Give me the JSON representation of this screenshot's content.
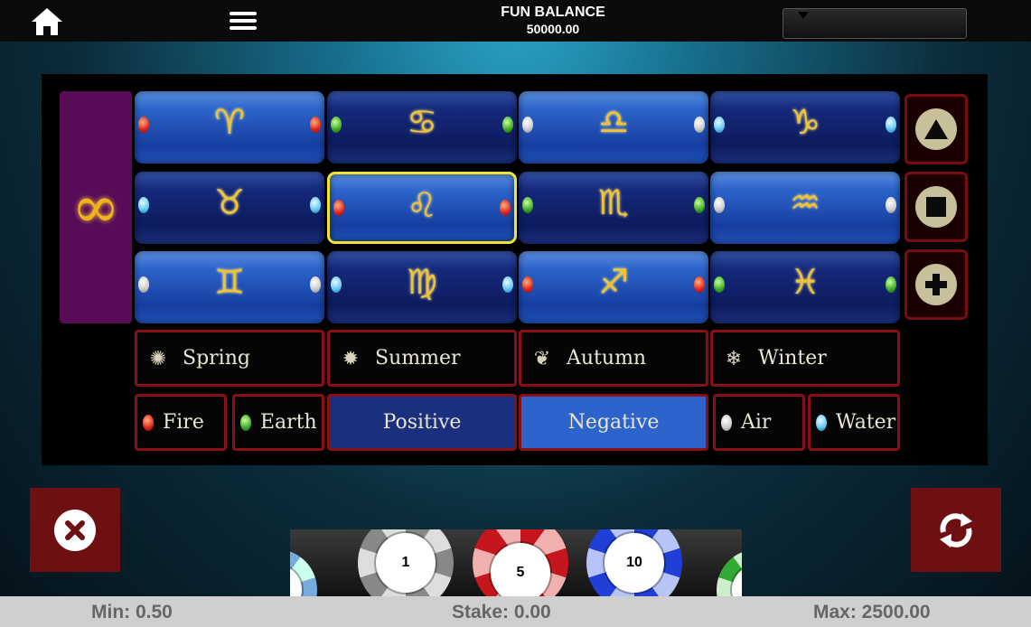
{
  "header": {
    "balance_label": "FUN BALANCE",
    "balance_value": "50000.00",
    "home_icon": "home-icon",
    "menu_icon": "hamburger-menu-icon"
  },
  "board": {
    "infinity_symbol": "∞",
    "signs": [
      {
        "glyph": "♈",
        "dots": [
          "red",
          "red"
        ],
        "shade": "light"
      },
      {
        "glyph": "♋",
        "dots": [
          "green",
          "green"
        ],
        "shade": "dark"
      },
      {
        "glyph": "♎",
        "dots": [
          "white",
          "white"
        ],
        "shade": "light"
      },
      {
        "glyph": "♑",
        "dots": [
          "blue",
          "blue"
        ],
        "shade": "dark"
      },
      {
        "glyph": "♉",
        "dots": [
          "blue",
          "blue"
        ],
        "shade": "dark"
      },
      {
        "glyph": "♌",
        "dots": [
          "red",
          "red"
        ],
        "shade": "light",
        "selected": true
      },
      {
        "glyph": "♏",
        "dots": [
          "green",
          "green"
        ],
        "shade": "dark"
      },
      {
        "glyph": "♒",
        "dots": [
          "white",
          "white"
        ],
        "shade": "light"
      },
      {
        "glyph": "♊",
        "dots": [
          "white",
          "white"
        ],
        "shade": "light"
      },
      {
        "glyph": "♍",
        "dots": [
          "blue",
          "blue"
        ],
        "shade": "dark"
      },
      {
        "glyph": "♐",
        "dots": [
          "red",
          "red"
        ],
        "shade": "light"
      },
      {
        "glyph": "♓",
        "dots": [
          "green",
          "green"
        ],
        "shade": "dark"
      }
    ],
    "seasons": [
      {
        "label": "Spring",
        "icon": "✺"
      },
      {
        "label": "Summer",
        "icon": "✹"
      },
      {
        "label": "Autumn",
        "icon": "❦"
      },
      {
        "label": "Winter",
        "icon": "❄"
      }
    ],
    "elements": {
      "fire": "Fire",
      "earth": "Earth",
      "positive": "Positive",
      "negative": "Negative",
      "air": "Air",
      "water": "Water"
    },
    "side_buttons": [
      "up-arrow-icon",
      "stop-square-icon",
      "plus-icon"
    ]
  },
  "chips": [
    {
      "value": "1",
      "color": "#9a9a9a"
    },
    {
      "value": "5",
      "color": "#c4161c"
    },
    {
      "value": "10",
      "color": "#1f3fd6"
    }
  ],
  "footer": {
    "min": "Min: 0.50",
    "stake": "Stake: 0.00",
    "max": "Max: 2500.00"
  }
}
